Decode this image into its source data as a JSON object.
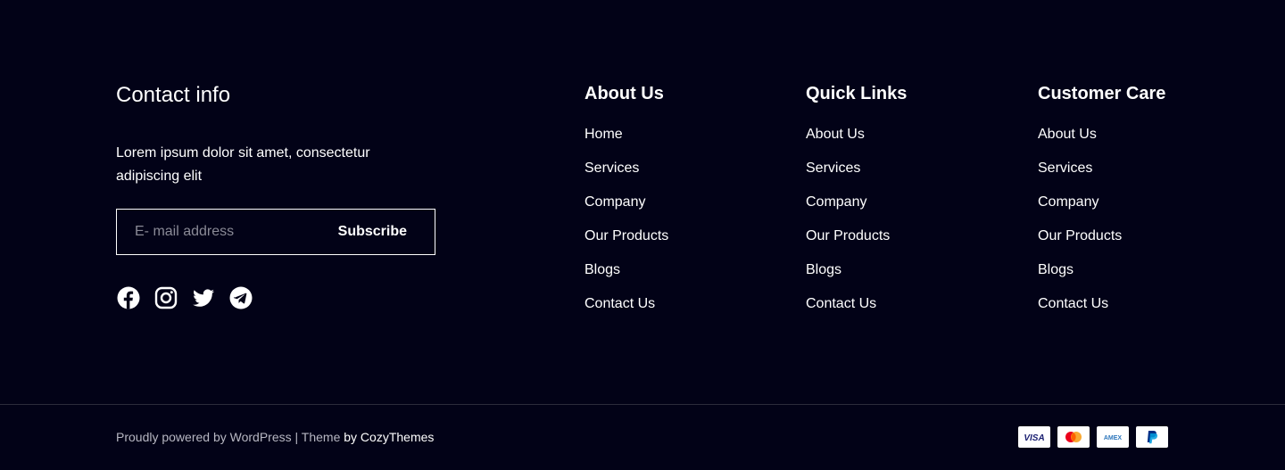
{
  "contact": {
    "title": "Contact info",
    "description": "Lorem ipsum dolor sit amet, consectetur adipiscing elit",
    "email_placeholder": "E- mail address",
    "subscribe_label": "Subscribe",
    "socials": [
      "facebook-icon",
      "instagram-icon",
      "twitter-icon",
      "telegram-icon"
    ]
  },
  "columns": [
    {
      "title": "About Us",
      "links": [
        "Home",
        "Services",
        "Company",
        "Our Products",
        "Blogs",
        "Contact Us"
      ]
    },
    {
      "title": "Quick Links",
      "links": [
        "About Us",
        "Services",
        "Company",
        "Our Products",
        "Blogs",
        "Contact Us"
      ]
    },
    {
      "title": "Customer Care",
      "links": [
        "About Us",
        "Services",
        "Company",
        "Our Products",
        "Blogs",
        "Contact Us"
      ]
    }
  ],
  "bottom": {
    "powered_text": "Proudly powered by WordPress",
    "separator": "|",
    "theme_label": "Theme",
    "theme_by": "by CozyThemes",
    "payment_cards": [
      {
        "name": "VISA",
        "color": "#1a1f71"
      },
      {
        "name": "Mastercard",
        "color": "#eb001b"
      },
      {
        "name": "AMEX",
        "color": "#2e77bc"
      },
      {
        "name": "PayPal",
        "color": "#003087"
      }
    ]
  },
  "colors": {
    "background": "#020217",
    "text": "#ffffff",
    "muted_text": "#b7b7c2",
    "divider": "#2b2b3b"
  }
}
